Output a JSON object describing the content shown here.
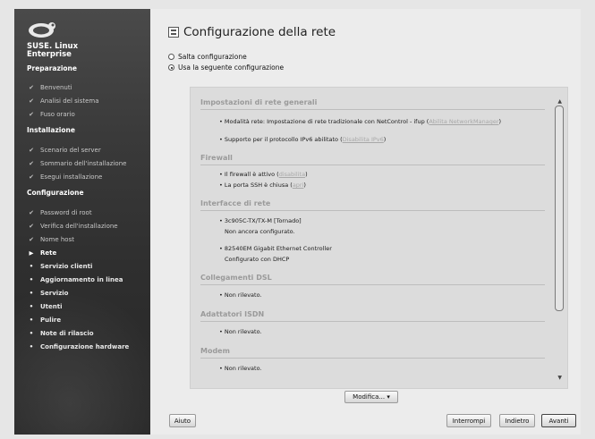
{
  "sidebar": {
    "brand_line1": "SUSE. Linux",
    "brand_line2": "Enterprise",
    "sections": [
      {
        "label": "Preparazione"
      },
      {
        "label": "Installazione"
      },
      {
        "label": "Configurazione"
      }
    ],
    "steps_preparazione": [
      "Benvenuti",
      "Analisi del sistema",
      "Fuso orario"
    ],
    "steps_installazione": [
      "Scenario del server",
      "Sommario dell'installazione",
      "Esegui installazione"
    ],
    "steps_configurazione_done": [
      "Password di root",
      "Verifica dell'installazione",
      "Nome host"
    ],
    "current_step": "Rete",
    "steps_future": [
      "Servizio clienti",
      "Aggiornamento in linea",
      "Servizio",
      "Utenti",
      "Pulire",
      "Note di rilascio",
      "Configurazione hardware"
    ]
  },
  "main": {
    "title": "Configurazione della rete",
    "options": [
      {
        "label": "Salta configurazione",
        "selected": false
      },
      {
        "label": "Usa la seguente configurazione",
        "selected": true
      }
    ],
    "summary": {
      "general_heading": "Impostazioni di rete generali",
      "general_lines": [
        {
          "text": "Modalità rete: Impostazione di rete tradizionale con NetControl - ifup (",
          "link": "Abilita NetworkManager",
          "tail": ")"
        },
        {
          "text": "Supporto per il protocollo IPv6 abilitato (",
          "link": "Disabilita IPv6",
          "tail": ")"
        }
      ],
      "firewall_heading": "Firewall",
      "firewall_lines": [
        {
          "text": "Il firewall è attivo (",
          "link": "disabilita",
          "tail": ")"
        },
        {
          "text": "La porta SSH è chiusa (",
          "link": "apri",
          "tail": ")"
        }
      ],
      "interfaces_heading": "Interfacce di rete",
      "interfaces": [
        {
          "name": "3c905C-TX/TX-M [Tornado]",
          "status": "Non ancora configurato."
        },
        {
          "name": "82540EM Gigabit Ethernet Controller",
          "status": "Configurato con DHCP"
        }
      ],
      "dsl_heading": "Collegamenti DSL",
      "dsl_status": "Non rilevato.",
      "isdn_heading": "Adattatori ISDN",
      "isdn_status": "Non rilevato.",
      "modem_heading": "Modem",
      "modem_status": "Non rilevato."
    },
    "modify_button": "Modifica...",
    "buttons": {
      "help": "Aiuto",
      "abort": "Interrompi",
      "back": "Indietro",
      "next": "Avanti"
    }
  }
}
